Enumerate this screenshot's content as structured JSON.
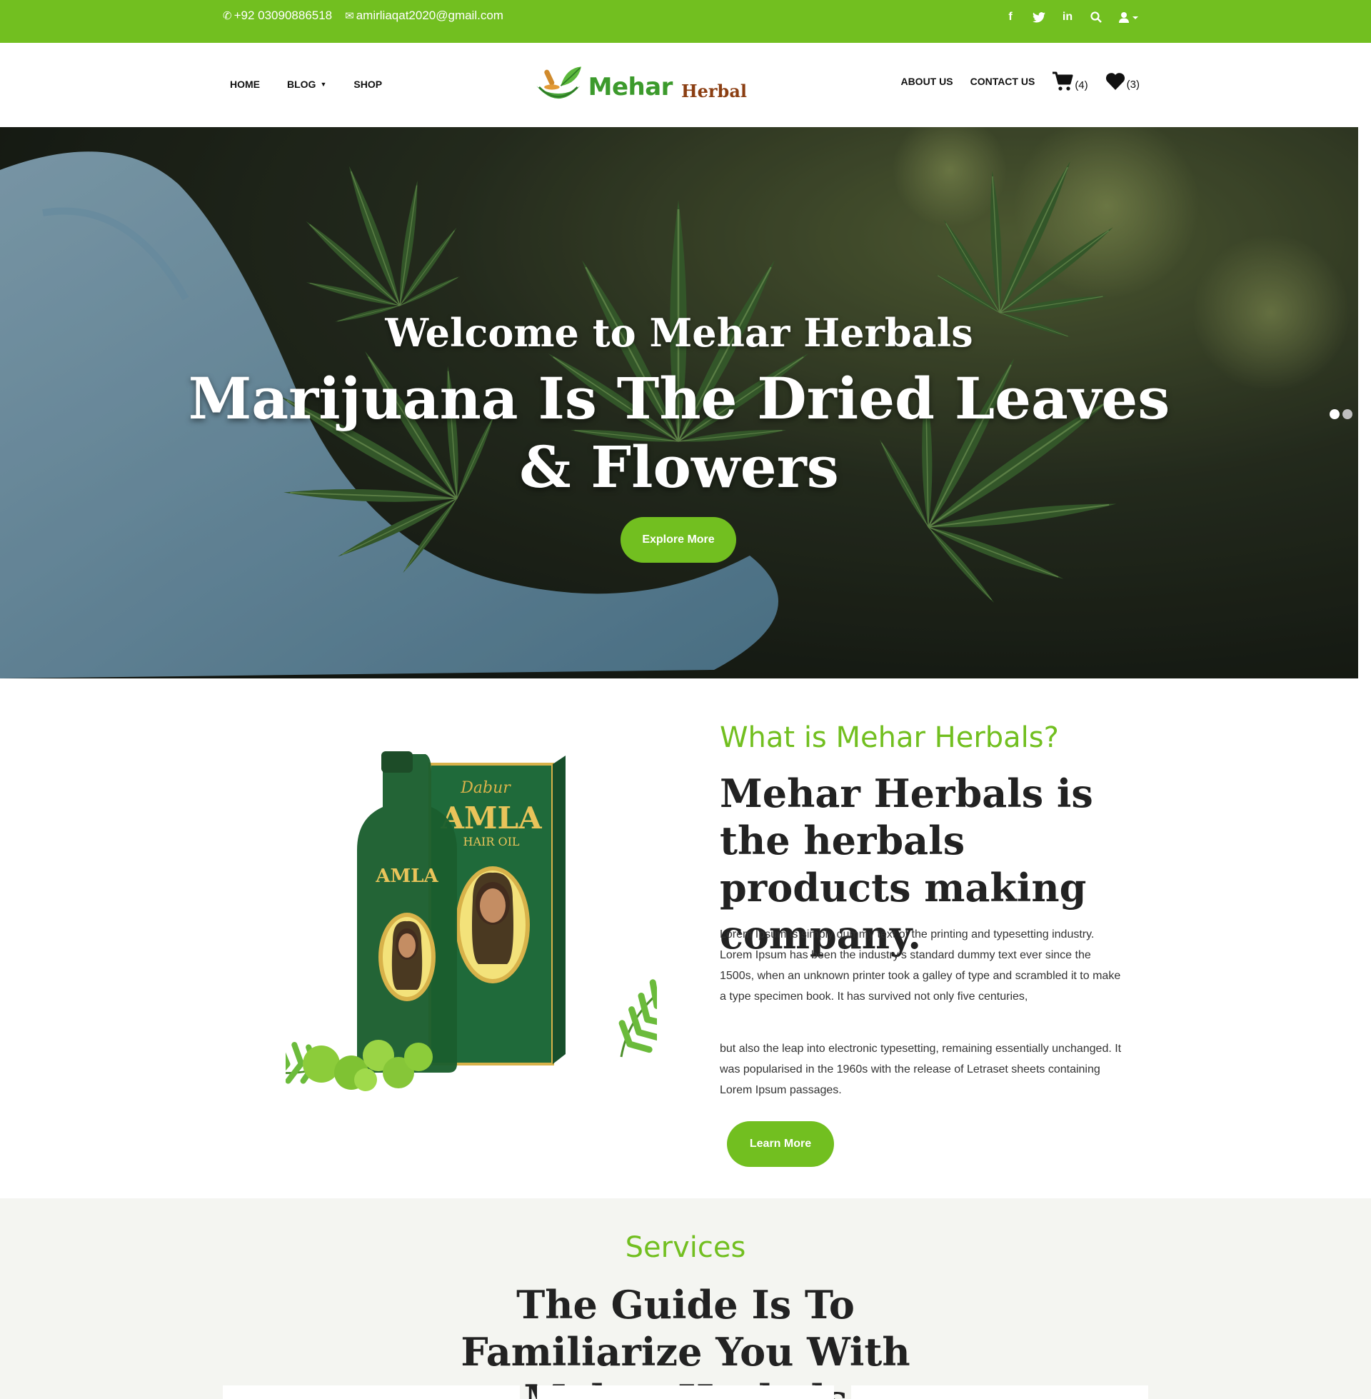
{
  "topbar": {
    "phone": "+92 03090886518",
    "email": "amirliaqat2020@gmail.com",
    "social_icons": [
      "facebook-icon",
      "twitter-icon",
      "linkedin-icon",
      "search-icon",
      "user-icon"
    ]
  },
  "nav": {
    "home": "HOME",
    "blog": "BLOG",
    "shop": "SHOP",
    "about": "ABOUT US",
    "contact": "CONTACT US",
    "cart_count": "(4)",
    "wishlist_count": "(3)"
  },
  "logo": {
    "brand1": "Mehar",
    "brand2": "Herbal"
  },
  "hero": {
    "welcome": "Welcome to Mehar Herbals",
    "title": "Marijuana Is The Dried Leaves & Flowers",
    "button": "Explore More",
    "slides": 2,
    "active_slide": 1
  },
  "about": {
    "subtitle": "What is Mehar Herbals?",
    "title": "Mehar Herbals is the herbals products making company.",
    "paragraph1": "Lorem Ipsum is simply dummy text of the printing and typesetting industry. Lorem Ipsum has been the industry's standard dummy text ever since the 1500s, when an unknown printer took a galley of type and scrambled it to make a type specimen book. It has survived not only five centuries,",
    "paragraph2": "but also the leap into electronic typesetting, remaining essentially unchanged. It was popularised in the 1960s with the release of Letraset sheets containing Lorem Ipsum passages.",
    "button": "Learn More",
    "product": {
      "brand": "Dabur",
      "name": "AMLA",
      "type": "HAIR OIL"
    }
  },
  "services": {
    "subtitle": "Services",
    "title": "The Guide Is To Familiarize You With Mehar Herbals"
  },
  "colors": {
    "accent": "#72bf20",
    "logo_green": "#3c9a2c",
    "logo_brown": "#8b3e12"
  }
}
